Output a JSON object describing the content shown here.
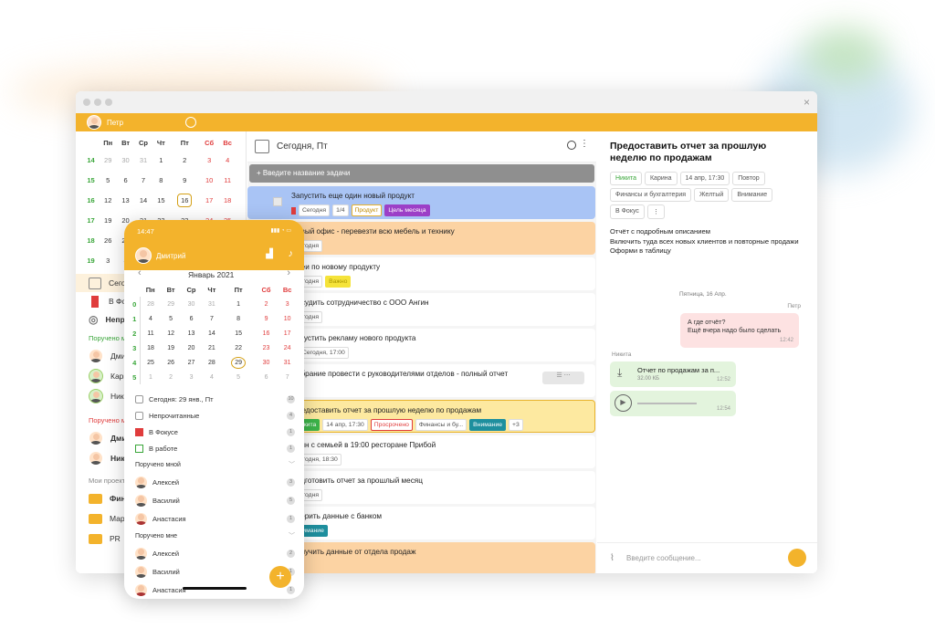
{
  "window": {
    "close_icon": "×"
  },
  "top_bar": {
    "user_name": "Петр"
  },
  "sidebar": {
    "weekdays": [
      "Пн",
      "Вт",
      "Ср",
      "Чт",
      "Пт",
      "Сб",
      "Вс"
    ],
    "weeks": [
      {
        "num": "14",
        "days": [
          "29",
          "30",
          "31",
          "1",
          "2",
          "3",
          "4"
        ]
      },
      {
        "num": "15",
        "days": [
          "5",
          "6",
          "7",
          "8",
          "9",
          "10",
          "11"
        ]
      },
      {
        "num": "16",
        "days": [
          "12",
          "13",
          "14",
          "15",
          "16",
          "17",
          "18"
        ]
      },
      {
        "num": "17",
        "days": [
          "19",
          "20",
          "21",
          "22",
          "23",
          "24",
          "25"
        ]
      },
      {
        "num": "18",
        "days": [
          "26",
          "27",
          "28",
          "29",
          "30",
          "1",
          "2"
        ]
      },
      {
        "num": "19",
        "days": [
          "3",
          "4",
          "5",
          "6",
          "7",
          "8",
          "9"
        ]
      }
    ],
    "nav_today": "Сегодня",
    "nav_focus": "В Фокусе",
    "nav_unread": "Непрочитанные",
    "assigned_me": "Поручено мне",
    "people_a": [
      "Дмитрий",
      "Карина",
      "Никита"
    ],
    "assigned_by_me": "Поручено мной",
    "people_b": [
      "Дмитрий",
      "Никита"
    ],
    "my_projects": "Мои проекты",
    "projects": [
      "Финансы и бухгалтерия",
      "Маркетинг",
      "PR"
    ]
  },
  "task_list": {
    "header": "Сегодня, Пт",
    "new_task_placeholder": "+ Введите название задачи",
    "tasks": [
      {
        "title": "Запустить еще один новый продукт",
        "tags": [
          "Сегодня",
          "1/4",
          "Продукт",
          "Цель месяца"
        ]
      },
      {
        "title": "Новый офис - перевезти всю мебель и технику",
        "tags": [
          "Сегодня"
        ]
      },
      {
        "title": "Идеи по новому продукту",
        "tags": [
          "Сегодня",
          "Важно"
        ]
      },
      {
        "title": "Обсудить сотрудничество с ООО Ангин",
        "tags": [
          "Сегодня"
        ]
      },
      {
        "title": "Запустить рекламу нового продукта",
        "tags": [
          "Сегодня, 17:00"
        ]
      },
      {
        "title": "Собрание провести с руководителями отделов - полный отчет",
        "tags": []
      },
      {
        "title": "Предоставить отчет за прошлую неделю по продажам",
        "tags": [
          "Никита",
          "14 апр, 17:30",
          "Просрочено",
          "Финансы и бу...",
          "Внимание",
          "+3"
        ]
      },
      {
        "title": "Ужин с семьей в 19:00 ресторане Прибой",
        "tags": [
          "Сегодня, 18:30"
        ]
      },
      {
        "title": "Подготовить отчет за прошлый месяц",
        "tags": [
          "Сегодня"
        ]
      },
      {
        "title": "Сверить данные с банком",
        "tags": [
          "Внимание"
        ]
      },
      {
        "title": "Получить данные от отдела продаж",
        "tags": []
      }
    ]
  },
  "detail": {
    "title": "Предоставить отчет за прошлую неделю по продажам",
    "chips": [
      "Никита",
      "Карина",
      "14 апр, 17:30",
      "Повтор",
      "Финансы и бухгалтерия",
      "Желтый",
      "Внимание",
      "В Фокус",
      "⋮"
    ],
    "description": [
      "Отчёт с подробным описанием",
      "Включить туда всех новых клиентов и повторные продажи",
      "Оформи в таблицу"
    ],
    "date_sep": "Пятница, 16 Апр.",
    "msg1": {
      "author": "Петр",
      "text": [
        "А где отчёт?",
        "Ещё вчера надо было сделать"
      ],
      "time": "12:42"
    },
    "msg2": {
      "author": "Никита",
      "file": "Отчет по продажам за п...",
      "size": "32.00 КБ",
      "time": "12:52"
    },
    "msg3": {
      "time": "12:54"
    },
    "input_placeholder": "Введите сообщение..."
  },
  "phone": {
    "time": "14:47",
    "user": "Дмитрий",
    "month": "Январь 2021",
    "weekdays": [
      "Пн",
      "Вт",
      "Ср",
      "Чт",
      "Пт",
      "Сб",
      "Вс"
    ],
    "weeks": [
      {
        "num": "0",
        "days": [
          "28",
          "29",
          "30",
          "31",
          "1",
          "2",
          "3"
        ]
      },
      {
        "num": "1",
        "days": [
          "4",
          "5",
          "6",
          "7",
          "8",
          "9",
          "10"
        ]
      },
      {
        "num": "2",
        "days": [
          "11",
          "12",
          "13",
          "14",
          "15",
          "16",
          "17"
        ]
      },
      {
        "num": "3",
        "days": [
          "18",
          "19",
          "20",
          "21",
          "22",
          "23",
          "24"
        ]
      },
      {
        "num": "4",
        "days": [
          "25",
          "26",
          "27",
          "28",
          "29",
          "30",
          "31"
        ]
      },
      {
        "num": "5",
        "days": [
          "1",
          "2",
          "3",
          "4",
          "5",
          "6",
          "7"
        ]
      }
    ],
    "today_label": "Сегодня: 29 янв., Пт",
    "today_count": "10",
    "unread": "Непрочитанные",
    "unread_count": "4",
    "focus": "В Фокусе",
    "focus_count": "1",
    "in_work": "В работе",
    "in_work_count": "1",
    "assigned_by_me": "Поручено мной",
    "people_by_me": [
      {
        "name": "Алексей",
        "count": "3"
      },
      {
        "name": "Василий",
        "count": "5"
      },
      {
        "name": "Анастасия",
        "count": "1"
      }
    ],
    "assigned_me": "Поручено мне",
    "people_me": [
      {
        "name": "Алексей",
        "count": "2"
      },
      {
        "name": "Василий",
        "count": "1"
      },
      {
        "name": "Анастасия",
        "count": "1"
      }
    ],
    "fab": "+"
  },
  "colors": {
    "accent": "#f3b32c",
    "green": "#3aa63a",
    "red": "#e03c3c",
    "teal": "#1e8f9e",
    "purple": "#9c3fc7"
  }
}
